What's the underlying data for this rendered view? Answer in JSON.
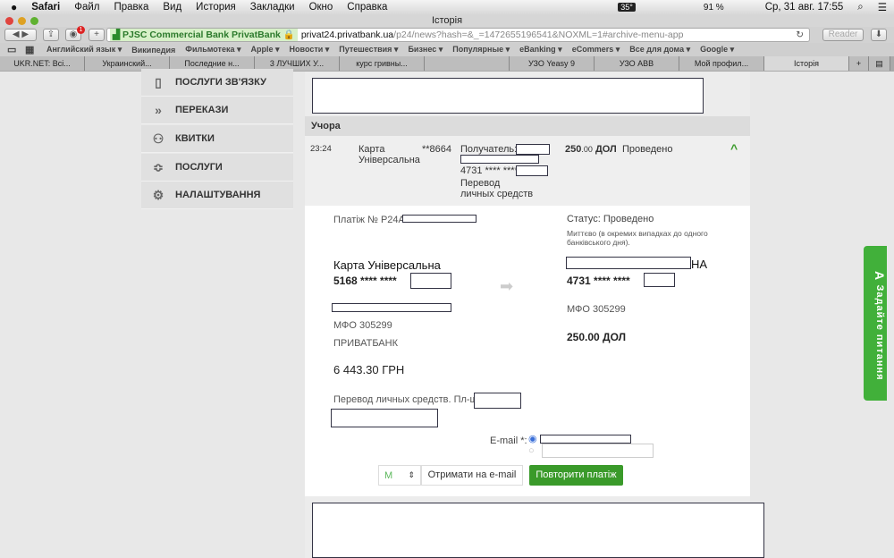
{
  "menubar": {
    "apple": "",
    "app": "Safari",
    "items": [
      "Файл",
      "Правка",
      "Вид",
      "История",
      "Закладки",
      "Окно",
      "Справка"
    ],
    "status": {
      "temp": "35°",
      "battery": "91 %",
      "datetime": "Ср, 31 авг.  17:55"
    }
  },
  "window": {
    "title": "Історія"
  },
  "toolbar": {
    "badge": "1",
    "site_identity": "PJSC Commercial Bank PrivatBank",
    "url_host": "privat24.privatbank.ua",
    "url_path": "/p24/news?hash=&_=1472655196541&NOXML=1#archive-menu-app",
    "reader": "Reader"
  },
  "bookmarks": [
    "Английский язык ▾",
    "Википедия",
    "Фильмотека ▾",
    "Apple ▾",
    "Новости ▾",
    "Путешествия ▾",
    "Бизнес ▾",
    "Популярные ▾",
    "eBanking ▾",
    "eCommers ▾",
    "Все для дома ▾",
    "Google ▾"
  ],
  "tabs": [
    {
      "label": "UKR.NET: Всі..."
    },
    {
      "label": "Украинский..."
    },
    {
      "label": "Последние н..."
    },
    {
      "label": "3 ЛУЧШИХ У..."
    },
    {
      "label": "курс гривны..."
    },
    {
      "label": ""
    },
    {
      "label": "УЗО Yeasy 9"
    },
    {
      "label": "УЗО ABB"
    },
    {
      "label": "Мой профил..."
    },
    {
      "label": "Історія",
      "active": true
    }
  ],
  "sidebar": {
    "items": [
      {
        "label": "ПОСЛУГИ ЗВ'ЯЗКУ",
        "icon": "phone-icon"
      },
      {
        "label": "ПЕРЕКАЗИ",
        "icon": "double-chevron-icon"
      },
      {
        "label": "КВИТКИ",
        "icon": "tickets-icon"
      },
      {
        "label": "ПОСЛУГИ",
        "icon": "layers-icon"
      },
      {
        "label": "НАЛАШТУВАННЯ",
        "icon": "gear-icon"
      }
    ]
  },
  "history": {
    "group": "Учора",
    "row": {
      "time": "23:24",
      "card": "Карта Універсальна",
      "card_mask": "**8664",
      "recipient_label": "Получатель: К",
      "recipient_card": "4731 **** **** 2",
      "purpose": "Перевод личных средств",
      "amount_int": "250",
      "amount_dec": ".00",
      "currency": "ДОЛ",
      "status": "Проведено"
    }
  },
  "detail": {
    "payment_no": "Платіж № P24A1",
    "status": "Статус: Проведено",
    "timing": "Миттєво (в окремих випадках до одного банківського дня).",
    "from_card_name": "Карта Універсальна",
    "from_card": "5168  ****  ****",
    "mfo_from": "МФО 305299",
    "bank_from": "ПРИВАТБАНК",
    "amount_from": "6 443.30 ГРН",
    "to_suffix": "НА",
    "to_card": "4731  ****  ****",
    "mfo_to": "МФО 305299",
    "amount_to": "250.00 ДОЛ",
    "purpose": "Перевод личных средств. Пл-щик:",
    "email_label": "E-mail *:",
    "email_button": "Отримати на e-mail",
    "repeat_button": "Повторити платіж"
  },
  "feedback": {
    "label": "Задайте питання"
  },
  "colors": {
    "accent": "#3a9a2a",
    "feedback": "#41b03a"
  }
}
